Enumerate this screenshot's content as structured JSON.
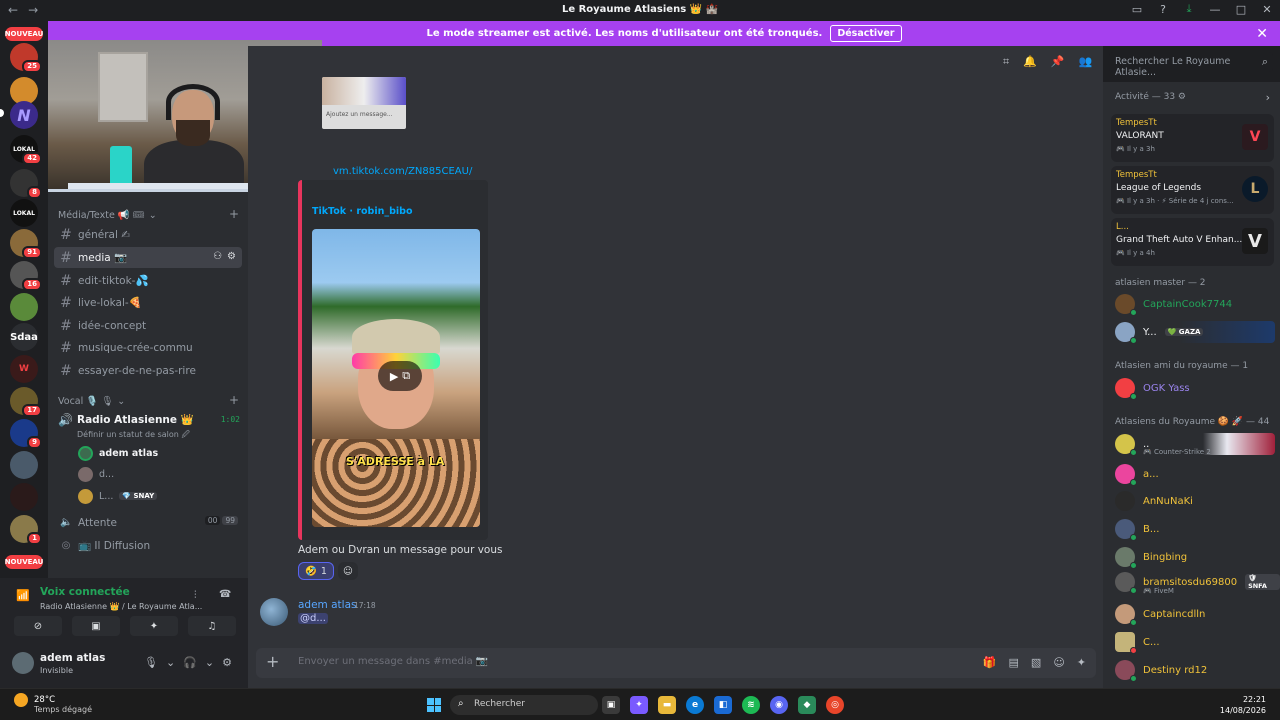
{
  "window": {
    "title": "Le Royaume Atlasiens 👑 🏰",
    "back_label": "←",
    "forward_label": "→",
    "icons": [
      "inbox-icon",
      "help-icon",
      "download-icon",
      "minimize-icon",
      "maximize-icon",
      "close-icon"
    ]
  },
  "banner": {
    "message": "Le mode streamer est activé. Les noms d'utilisateur ont été tronqués.",
    "button": "Désactiver",
    "close": "✕"
  },
  "guilds": {
    "new_label": "NOUVEAU",
    "badges": [
      "25",
      "42",
      "8",
      "91",
      "16",
      "17",
      "9",
      "1"
    ],
    "text_guild": "Sdaa"
  },
  "sidebar": {
    "category_text": "Média/Texte 📢 🎟",
    "channels": [
      {
        "name": "général ✍",
        "active": false
      },
      {
        "name": "media 📷",
        "active": true
      },
      {
        "name": "edit-tiktok-💦",
        "active": false
      },
      {
        "name": "live-lokal-🍕",
        "active": false
      },
      {
        "name": "idée-concept",
        "active": false
      },
      {
        "name": "musique-crée-commu",
        "active": false
      },
      {
        "name": "essayer-de-ne-pas-rire",
        "active": false
      }
    ],
    "category_voice": "Vocal 🎙️ 🎙",
    "voice_channel": {
      "name": "Radio Atlasienne 👑",
      "time": "1:02",
      "status": "Définir un statut de salon 🖉",
      "users": [
        {
          "name": "adem atlas",
          "tag": ""
        },
        {
          "name": "d...",
          "tag": ""
        },
        {
          "name": "L...",
          "tag": "💎 SNAY"
        }
      ]
    },
    "attente": {
      "name": "Attente",
      "count_left": "00",
      "count_right": "99"
    },
    "diffusion": "📺 Il Diffusion"
  },
  "voice_panel": {
    "connected": "Voix connectée",
    "subtitle": "Radio Atlasienne 👑 / Le Royaume Atla...",
    "buttons": [
      "camera-off",
      "screen-share",
      "activities",
      "soundboard"
    ]
  },
  "me": {
    "name": "adem atlas",
    "status": "Invisible"
  },
  "header": {
    "search_placeholder": "Rechercher Le Royaume Atlasie..."
  },
  "chat": {
    "thumb_caption": "Ajoutez un message...",
    "link": "vm.tiktok.com/ZN885CEAU/",
    "link_prefix": "ok",
    "embed_title": "TikTok · robin_bibo",
    "video_caption": "S'ADRESSE à LA",
    "message": "Adem ou Dvran un message pour vous",
    "reaction_emoji": "🤣",
    "reaction_count": "1",
    "author": "adem atlas",
    "time": "17:18",
    "mention": "@d...",
    "composer_placeholder": "Envoyer un message dans #media 📷"
  },
  "members": {
    "activity_header": "Activité — 33 ⚙",
    "activities": [
      {
        "user": "TempesTt",
        "game": "VALORANT",
        "meta": "🎮 Il y a 3h",
        "art": "V"
      },
      {
        "user": "TempesTt",
        "game": "League of Legends",
        "meta": "🎮 Il y a 3h · ⚡ Série de 4 j cons...",
        "art": "L"
      },
      {
        "user": "L...",
        "game": "Grand Theft Auto V Enhan...",
        "meta": "🎮 Il y a 4h",
        "art": "V"
      }
    ],
    "groups": [
      {
        "title": "atlasien master — 2",
        "members": [
          {
            "name": "CaptainCook7744",
            "color": "#23a55a",
            "sub": ""
          },
          {
            "name": "Y...",
            "color": "#f2f3f5",
            "sub": "",
            "tag": "💚 GAZA"
          }
        ]
      },
      {
        "title": "Atlasien ami du royaume — 1",
        "members": [
          {
            "name": "OGK Yass",
            "color": "#9b84ee",
            "sub": ""
          }
        ]
      },
      {
        "title": "Atlasiens du Royaume 🍪 🚀 — 44",
        "members": [
          {
            "name": "..",
            "color": "#f2f3f5",
            "sub": "🎮 Counter-Strike 2"
          },
          {
            "name": "a...",
            "color": "#f0c23a",
            "sub": ""
          },
          {
            "name": "AnNuNaKi",
            "color": "#f0c23a",
            "sub": ""
          },
          {
            "name": "B...",
            "color": "#f0c23a",
            "sub": ""
          },
          {
            "name": "Bingbing",
            "color": "#f0c23a",
            "sub": ""
          },
          {
            "name": "bramsitosdu69800",
            "color": "#f0c23a",
            "sub": "🎮 FiveM",
            "tag": "🛡 SNFA"
          },
          {
            "name": "Captaincdlln",
            "color": "#f0c23a",
            "sub": ""
          },
          {
            "name": "C...",
            "color": "#f0c23a",
            "sub": ""
          },
          {
            "name": "Destiny rd12",
            "color": "#f0c23a",
            "sub": ""
          }
        ]
      }
    ]
  },
  "taskbar": {
    "temp": "28°C",
    "weather": "Temps dégagé",
    "search": "Rechercher",
    "time": "22:21",
    "date": "14/08/2026"
  }
}
